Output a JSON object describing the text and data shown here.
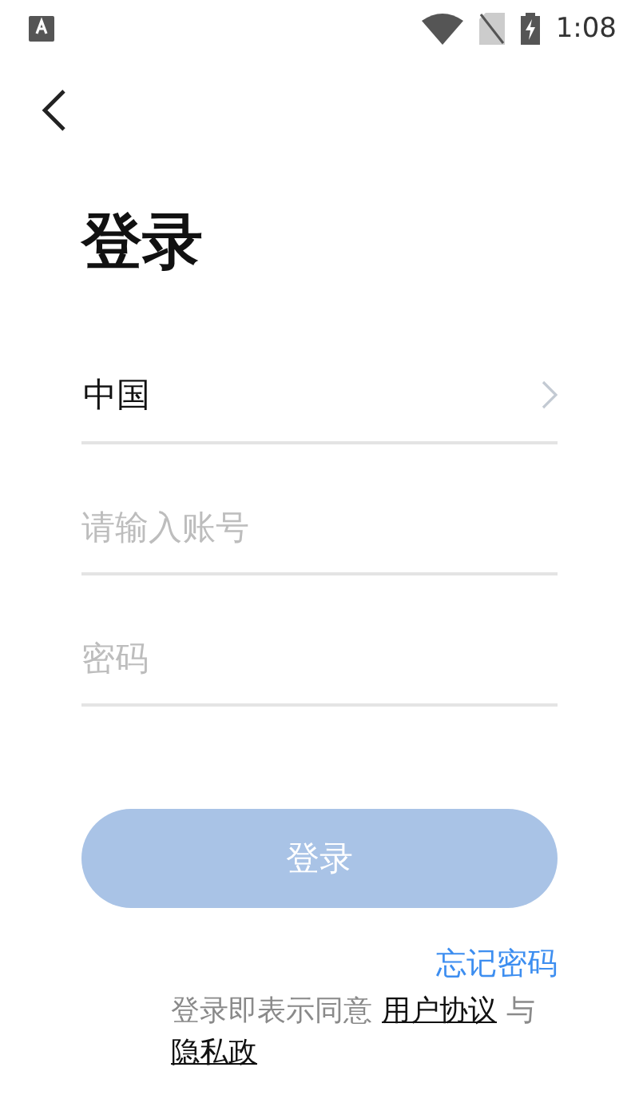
{
  "status_bar": {
    "time": "1:08"
  },
  "title": "登录",
  "region": {
    "value": "中国"
  },
  "account": {
    "placeholder": "请输入账号"
  },
  "password": {
    "placeholder": "密码"
  },
  "login_button": {
    "label": "登录",
    "disabled": true
  },
  "forgot_password": "忘记密码",
  "agreement": {
    "prefix": "登录即表示同意",
    "terms_link": "用户协议",
    "joiner": "与",
    "privacy_link": "隐私政"
  }
}
